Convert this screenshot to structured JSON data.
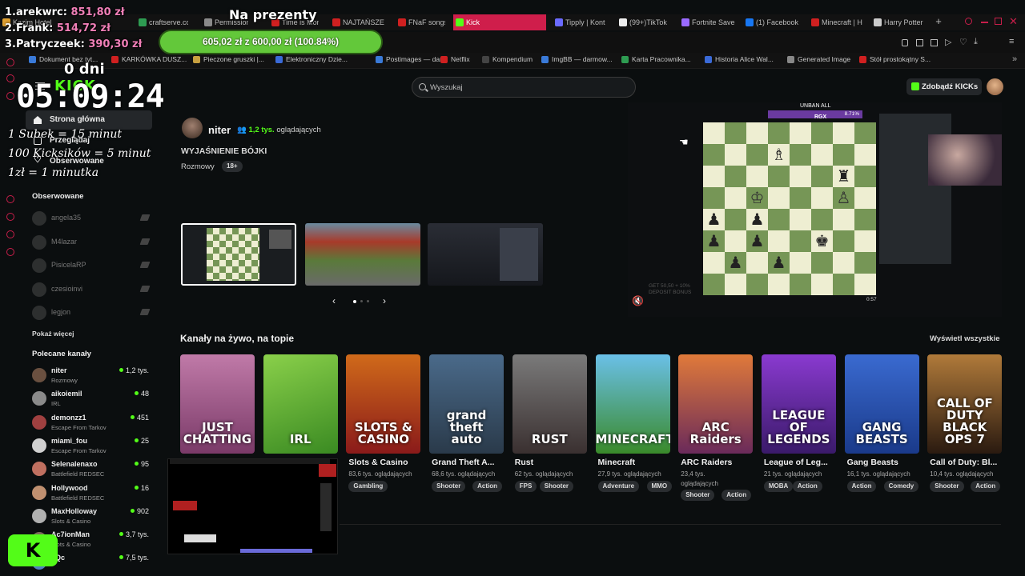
{
  "overlay": {
    "goal_title": "Na prezenty",
    "leaderboard": [
      {
        "rank_name": "1.arekwrc:",
        "amount": "851,80 zł"
      },
      {
        "rank_name": "2.Frank:",
        "amount": "514,72 zł"
      },
      {
        "rank_name": "3.Patryczeek:",
        "amount": "390,30 zł"
      }
    ],
    "goal_progress_text": "605,02 zł z 600,00 zł (100.84%)",
    "goal_progress_fraction": 1.0084,
    "days": "0 dni",
    "timer": "05:09:24",
    "rules": [
      "1 Subek = 15 minut",
      "100 Kicksików = 5 minut",
      "1zł = 1 minutka"
    ]
  },
  "browser": {
    "tabs": [
      {
        "label": "Kazim Hotel",
        "color": "#e0a030"
      },
      {
        "label": "craftserve.co",
        "color": "#2e9c52"
      },
      {
        "label": "Permissions",
        "color": "#8a8a8a"
      },
      {
        "label": "Time is Mon",
        "color": "#d02020"
      },
      {
        "label": "NAJTAŃSZE",
        "color": "#d02020"
      },
      {
        "label": "FNaF songs",
        "color": "#d02020"
      },
      {
        "label": "Kick",
        "color": "#53fc18",
        "active": true
      },
      {
        "label": "Tipply | Kont",
        "color": "#6a6aff"
      },
      {
        "label": "(99+)TikTok",
        "color": "#eeeeee"
      },
      {
        "label": "Fortnite Save",
        "color": "#9a6aff"
      },
      {
        "label": "(1) Facebook",
        "color": "#1877f2"
      },
      {
        "label": "Minecraft | H",
        "color": "#d02020"
      },
      {
        "label": "Harry Potter",
        "color": "#cccccc"
      }
    ],
    "bookmarks": [
      {
        "label": "Dokument bez tyt...",
        "color": "#3a7ad8"
      },
      {
        "label": "KARKÓWKA DUSZ...",
        "color": "#d02020"
      },
      {
        "label": "Pieczone gruszki |...",
        "color": "#c8a040"
      },
      {
        "label": "Elektroniczny Dzie...",
        "color": "#3a6ad8"
      },
      {
        "label": "Postimages — dar...",
        "color": "#3a7ad8"
      },
      {
        "label": "Netflix",
        "color": "#d02020"
      },
      {
        "label": "Kompendium",
        "color": "#444444"
      },
      {
        "label": "ImgBB — darmow...",
        "color": "#3a7ad8"
      },
      {
        "label": "Karta Pracownika...",
        "color": "#2e9c52"
      },
      {
        "label": "Historia Alice Wal...",
        "color": "#3a6ad8"
      },
      {
        "label": "Generated Image",
        "color": "#888888"
      },
      {
        "label": "Stół prostokątny S...",
        "color": "#d02020"
      }
    ]
  },
  "header": {
    "search_placeholder": "Wyszukaj",
    "kicks_button": "Zdobądź KICKs"
  },
  "sidebar": {
    "nav": [
      {
        "label": "Strona główna",
        "icon": "home-icon"
      },
      {
        "label": "Przeglądaj",
        "icon": "browse-icon"
      },
      {
        "label": "Obserwowane",
        "icon": "heart-icon"
      }
    ],
    "followed_title": "Obserwowane",
    "followed": [
      "angela35",
      "M4lazar",
      "PisicelaRP",
      "czesioinvi",
      "legjon"
    ],
    "show_more": "Pokaż więcej",
    "recommended_title": "Polecane kanały",
    "recommended": [
      {
        "name": "niter",
        "category": "Rozmowy",
        "viewers": "1,2 tys.",
        "color": "#6a5040"
      },
      {
        "name": "aikoiemil",
        "category": "IRL",
        "viewers": "48",
        "color": "#8a8a8a"
      },
      {
        "name": "demonzz1",
        "category": "Escape From Tarkov",
        "viewers": "451",
        "color": "#a04040"
      },
      {
        "name": "miami_fou",
        "category": "Escape From Tarkov",
        "viewers": "25",
        "color": "#d0d0d0"
      },
      {
        "name": "Selenalenaxo",
        "category": "Battlefield REDSEC",
        "viewers": "95",
        "color": "#c07060"
      },
      {
        "name": "Hollywood",
        "category": "Battlefield REDSEC",
        "viewers": "16",
        "color": "#c09070"
      },
      {
        "name": "MaxHolloway",
        "category": "Slots & Casino",
        "viewers": "902",
        "color": "#b0b0b0"
      },
      {
        "name": "Ac7ionMan",
        "category": "Slots & Casino",
        "viewers": "3,7 tys.",
        "color": "#7a6a5a"
      },
      {
        "name": "xQc",
        "category": "",
        "viewers": "7,5 tys.",
        "color": "#5080c0"
      }
    ]
  },
  "featured": {
    "streamer": "niter",
    "viewers": "1,2 tys.",
    "viewers_suffix": "oglądających",
    "title": "WYJAŚNIENIE BÓJKI",
    "category": "Rozmowy",
    "age_badge": "18+",
    "player_overlay_top": "UNBAN ALL",
    "player_percent": "8.71%",
    "player_caption": "RGX",
    "player_promo": "GET 50,50 + 10% DEPOSIT BONUS",
    "player_clock": "0:57",
    "mute_icon": "mute-icon",
    "carousel_active_index": 0
  },
  "live_section": {
    "title": "Kanały na żywo, na topie",
    "see_all": "Wyświetl wszystkie"
  },
  "categories": [
    {
      "name": "Just Chatting",
      "art": "JUST\nCHATTING",
      "views": "",
      "tags": [],
      "bg": "linear-gradient(180deg,#c07aa8,#7a3a68)"
    },
    {
      "name": "IRL",
      "art": "IRL",
      "views": "",
      "tags": [],
      "bg": "linear-gradient(160deg,#8ad04a,#3a8a22)"
    },
    {
      "name": "Slots & Casino",
      "art": "SLOTS &\nCASINO",
      "views": "83,6 tys. oglądających",
      "tags": [
        "Gambling"
      ],
      "bg": "linear-gradient(180deg,#d06a1a,#8a1a1a)"
    },
    {
      "name": "Grand Theft A...",
      "art": "grand\ntheft\nauto",
      "views": "68,6 tys. oglądających",
      "tags": [
        "Shooter",
        "Action"
      ],
      "bg": "linear-gradient(180deg,#4a6a8a,#2a3a4a)"
    },
    {
      "name": "Rust",
      "art": "RUST",
      "views": "62 tys. oglądających",
      "tags": [
        "FPS",
        "Shooter"
      ],
      "bg": "linear-gradient(180deg,#7a7a7a,#3a3030)"
    },
    {
      "name": "Minecraft",
      "art": "MINECRAFT",
      "views": "27,9 tys. oglądających",
      "tags": [
        "Adventure",
        "MMO"
      ],
      "bg": "linear-gradient(180deg,#6ac0e8,#3a8a2a)"
    },
    {
      "name": "ARC Raiders",
      "art": "ARC\nRaiders",
      "views": "23,4 tys. oglądających",
      "tags": [
        "Shooter",
        "Action"
      ],
      "bg": "linear-gradient(180deg,#e07a3a,#6a2a5a)"
    },
    {
      "name": "League of Leg...",
      "art": "LEAGUE OF\nLEGENDS",
      "views": "21 tys. oglądających",
      "tags": [
        "MOBA",
        "Action"
      ],
      "bg": "linear-gradient(180deg,#8a3ad0,#3a1a6a)"
    },
    {
      "name": "Gang Beasts",
      "art": "GANG\nBEASTS",
      "views": "16,1 tys. oglądających",
      "tags": [
        "Action",
        "Comedy"
      ],
      "bg": "linear-gradient(180deg,#3a6ad0,#1a3a8a)"
    },
    {
      "name": "Call of Duty: Bl...",
      "art": "CALL OF DUTY\nBLACK OPS 7",
      "views": "10,4 tys. oglądających",
      "tags": [
        "Shooter",
        "Action"
      ],
      "bg": "linear-gradient(180deg,#b07a3a,#2a1a10)"
    }
  ],
  "colors": {
    "kick_green": "#53fc18",
    "accent_pink": "#cf1e4b",
    "board_light": "#eeeed2",
    "board_dark": "#769656"
  }
}
